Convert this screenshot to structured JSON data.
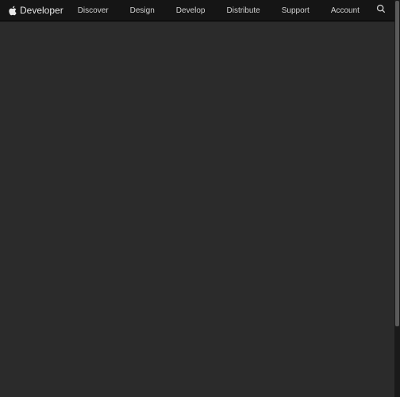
{
  "brand": {
    "label": "Developer"
  },
  "nav": {
    "items": [
      {
        "label": "Discover"
      },
      {
        "label": "Design"
      },
      {
        "label": "Develop"
      },
      {
        "label": "Distribute"
      },
      {
        "label": "Support"
      },
      {
        "label": "Account"
      }
    ]
  }
}
